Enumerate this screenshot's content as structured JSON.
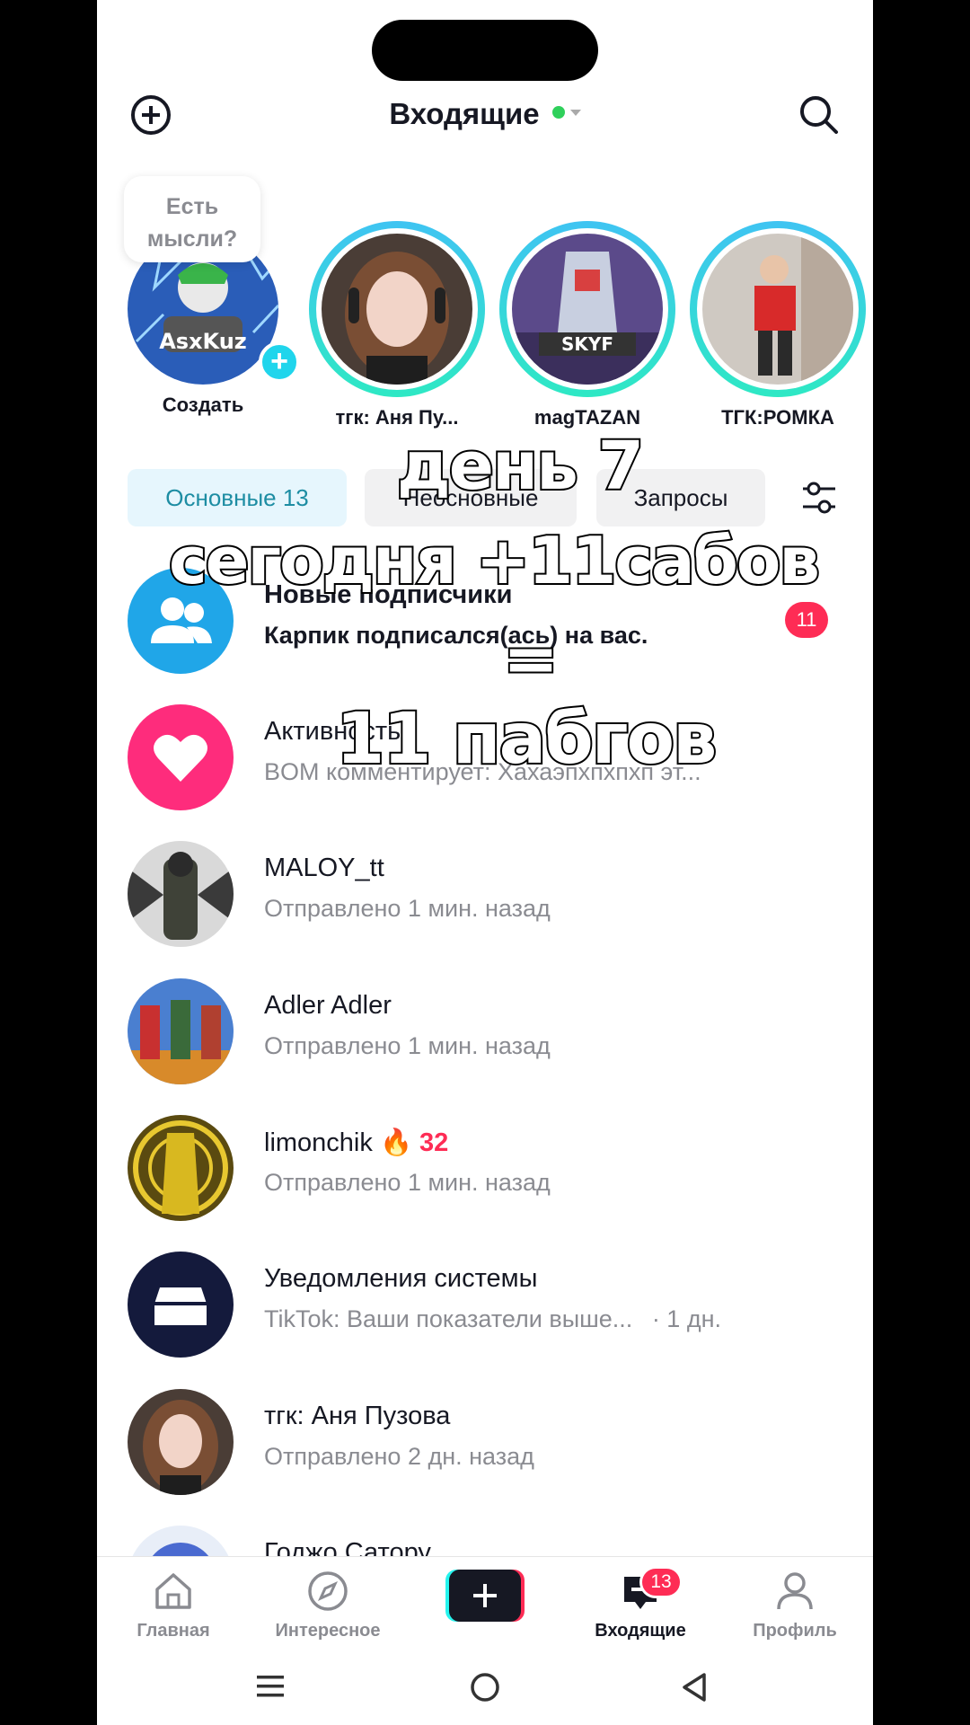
{
  "header": {
    "title": "Входящие"
  },
  "stories": {
    "thoughts_bubble": "Есть мысли?",
    "own_label": "Создать",
    "own_avatar_text": "AsxKuz",
    "items": [
      {
        "label": "тгк: Аня Пу..."
      },
      {
        "label": "magTAZAN",
        "avatar_text": "SKYF"
      },
      {
        "label": "ТГК:РОМКА"
      }
    ]
  },
  "tabs": [
    {
      "label": "Основные 13"
    },
    {
      "label": "Неосновные"
    },
    {
      "label": "Запросы"
    }
  ],
  "messages": [
    {
      "name": "Новые подписчики",
      "sub": "Карпик подписался(ась) на вас.",
      "badge": "11"
    },
    {
      "name": "Активность",
      "sub": "BOM комментирует: Хахаэпхпхпхп эт..."
    },
    {
      "name": "MALOY_tt",
      "sub": "Отправлено 1 мин. назад"
    },
    {
      "name": "Adler Adler",
      "sub": "Отправлено 1 мин. назад"
    },
    {
      "name": "limonchik",
      "streak": "32",
      "sub": "Отправлено 1 мин. назад"
    },
    {
      "name": "Уведомления системы",
      "sub": "TikTok: Ваши показатели выше...",
      "time": "· 1 дн."
    },
    {
      "name": "тгк: Аня Пузова",
      "sub": "Отправлено 2 дн. назад"
    },
    {
      "name": "Годжо Сатору"
    }
  ],
  "overlay": {
    "line1": "день 7",
    "line2": "сегодня +11сабов",
    "line3": "=",
    "line4": "11 пабгов"
  },
  "nav": {
    "home": "Главная",
    "discover": "Интересное",
    "inbox": "Входящие",
    "inbox_count": "13",
    "profile": "Профиль"
  },
  "colors": {
    "accent_red": "#fe2c55",
    "accent_cyan": "#20d5ec",
    "followers_blue": "#20a6e8",
    "activity_pink": "#fe2c7c",
    "system_navy": "#141a3c"
  }
}
